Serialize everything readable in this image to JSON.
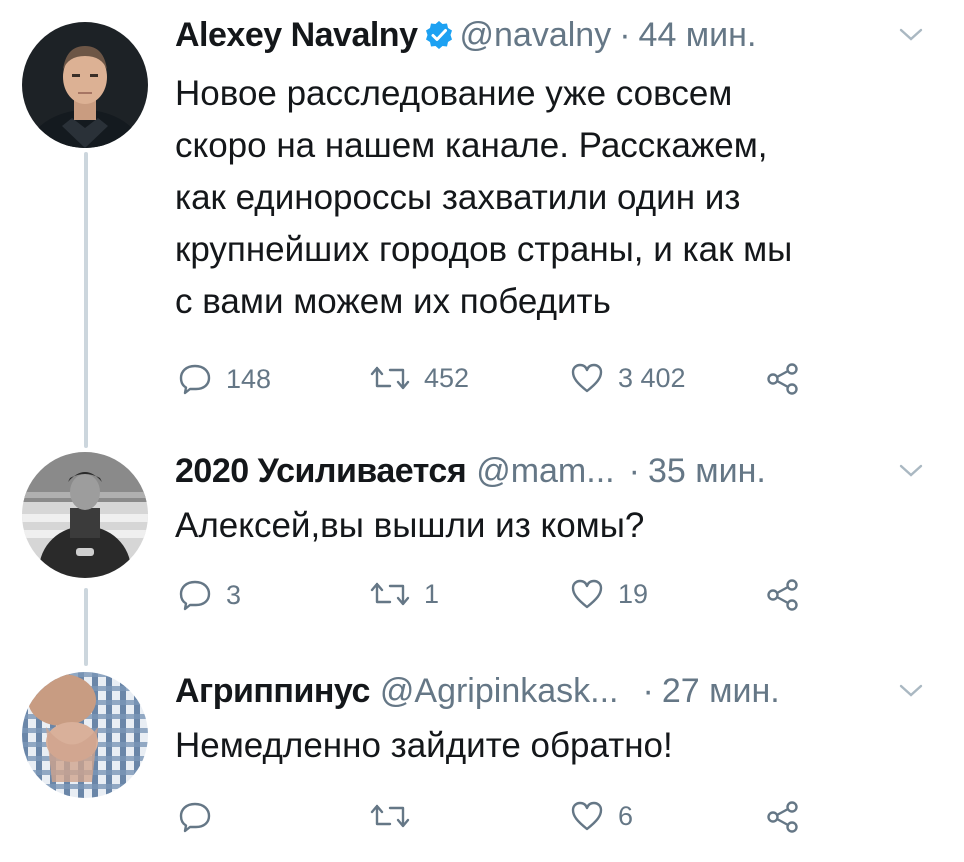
{
  "colors": {
    "text": "#14171a",
    "secondary": "#657786",
    "verified": "#1da1f2",
    "thread_line": "#ccd6dd"
  },
  "tweets": [
    {
      "name": "Alexey Navalny",
      "verified": true,
      "handle": "@navalny",
      "separator": "·",
      "time": "44 мин.",
      "body_lines": [
        "Новое расследование уже совсем",
        "скоро на нашем канале. Расскажем,",
        "как единороссы захватили один из",
        "крупнейших городов страны, и как мы",
        "с вами можем их победить"
      ],
      "replies": "148",
      "retweets": "452",
      "likes": "3 402"
    },
    {
      "name": "2020 Усиливается",
      "verified": false,
      "handle": "@mam...",
      "separator": "·",
      "time": "35 мин.",
      "body_lines": [
        "Алексей,вы вышли из комы?"
      ],
      "replies": "3",
      "retweets": "1",
      "likes": "19"
    },
    {
      "name": "Агриппинус",
      "verified": false,
      "handle": "@Agripinkask...",
      "separator": "·",
      "time": "27 мин.",
      "body_lines": [
        "Немедленно зайдите обратно!"
      ],
      "replies": "",
      "retweets": "",
      "likes": "6"
    }
  ],
  "icons": {
    "reply": "reply-icon",
    "retweet": "retweet-icon",
    "like": "heart-icon",
    "share": "share-icon",
    "more": "chevron-down-icon",
    "verified": "verified-badge-icon"
  }
}
